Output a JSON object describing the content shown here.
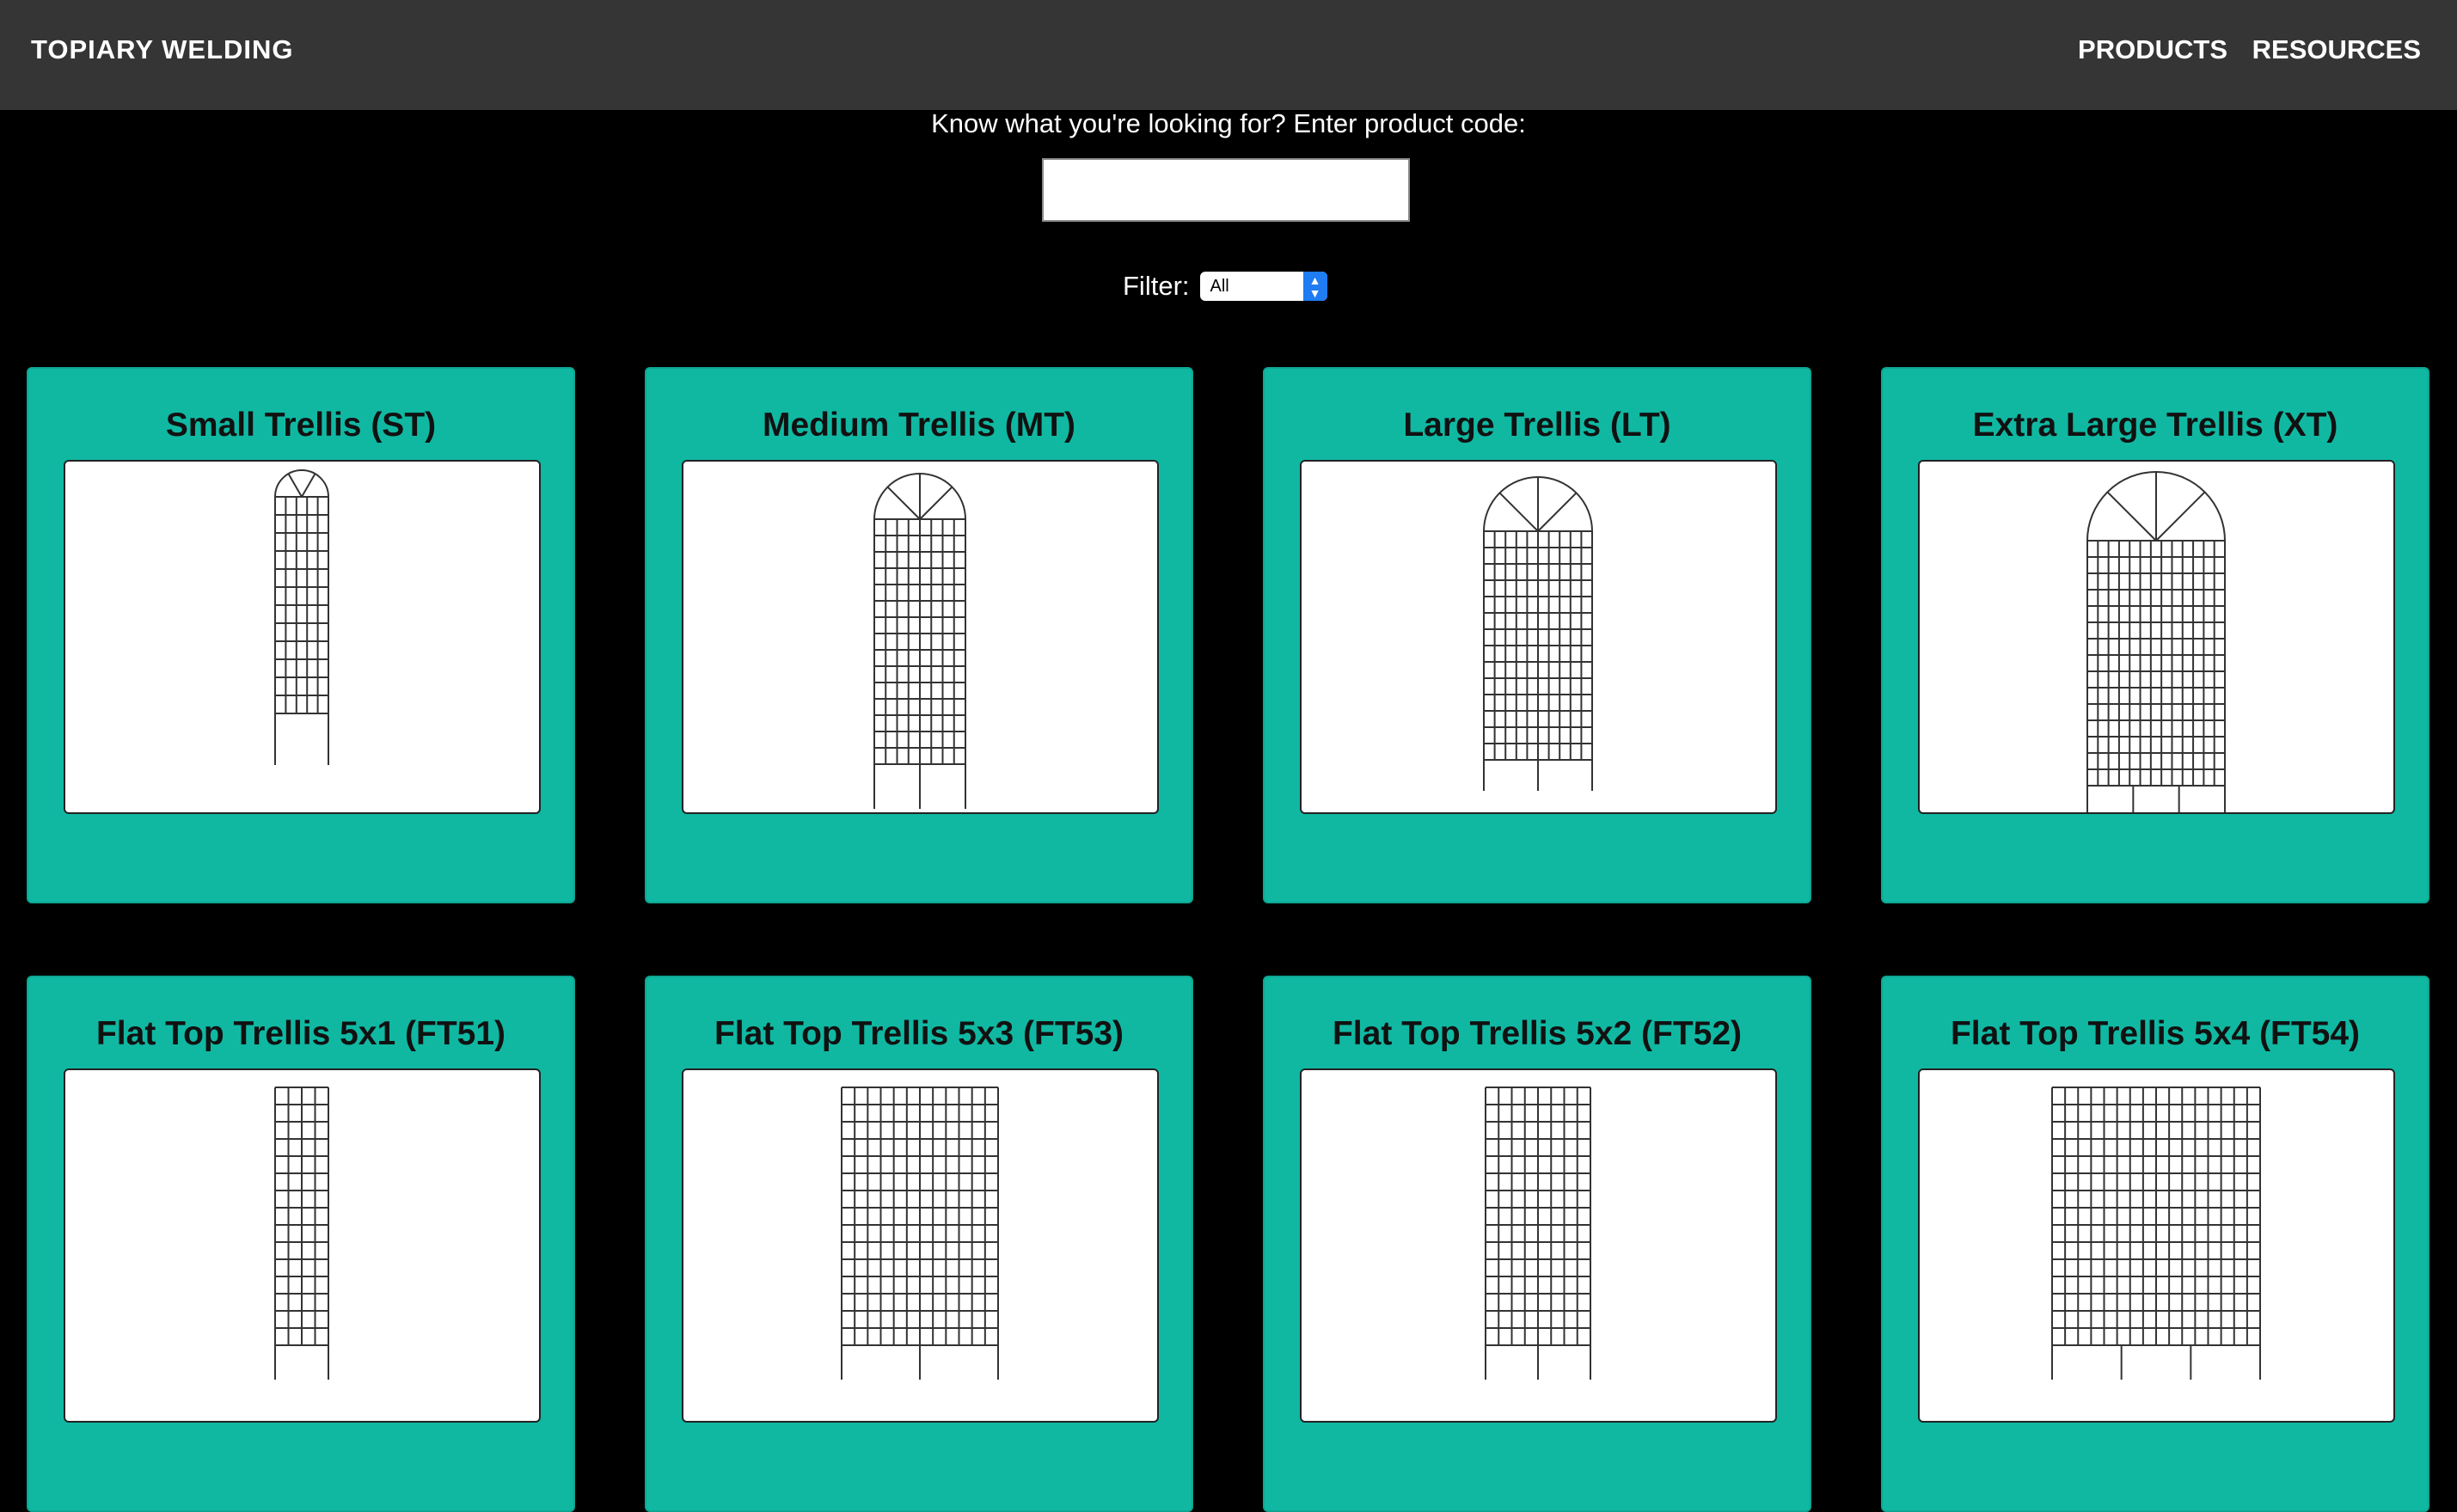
{
  "nav": {
    "brand": "TOPIARY WELDING",
    "links": [
      "PRODUCTS",
      "RESOURCES"
    ]
  },
  "search": {
    "label": "Know what you're looking for? Enter product code:",
    "value": ""
  },
  "filter": {
    "label": "Filter:",
    "selected": "All"
  },
  "products": [
    {
      "title": "Small Trellis (ST)",
      "code": "ST",
      "style": "arch"
    },
    {
      "title": "Medium Trellis (MT)",
      "code": "MT",
      "style": "arch"
    },
    {
      "title": "Large Trellis (LT)",
      "code": "LT",
      "style": "arch"
    },
    {
      "title": "Extra Large Trellis (XT)",
      "code": "XT",
      "style": "arch"
    },
    {
      "title": "Flat Top Trellis 5x1 (FT51)",
      "code": "FT51",
      "style": "flat"
    },
    {
      "title": "Flat Top Trellis 5x3 (FT53)",
      "code": "FT53",
      "style": "flat"
    },
    {
      "title": "Flat Top Trellis 5x2 (FT52)",
      "code": "FT52",
      "style": "flat"
    },
    {
      "title": "Flat Top Trellis 5x4 (FT54)",
      "code": "FT54",
      "style": "flat"
    }
  ]
}
